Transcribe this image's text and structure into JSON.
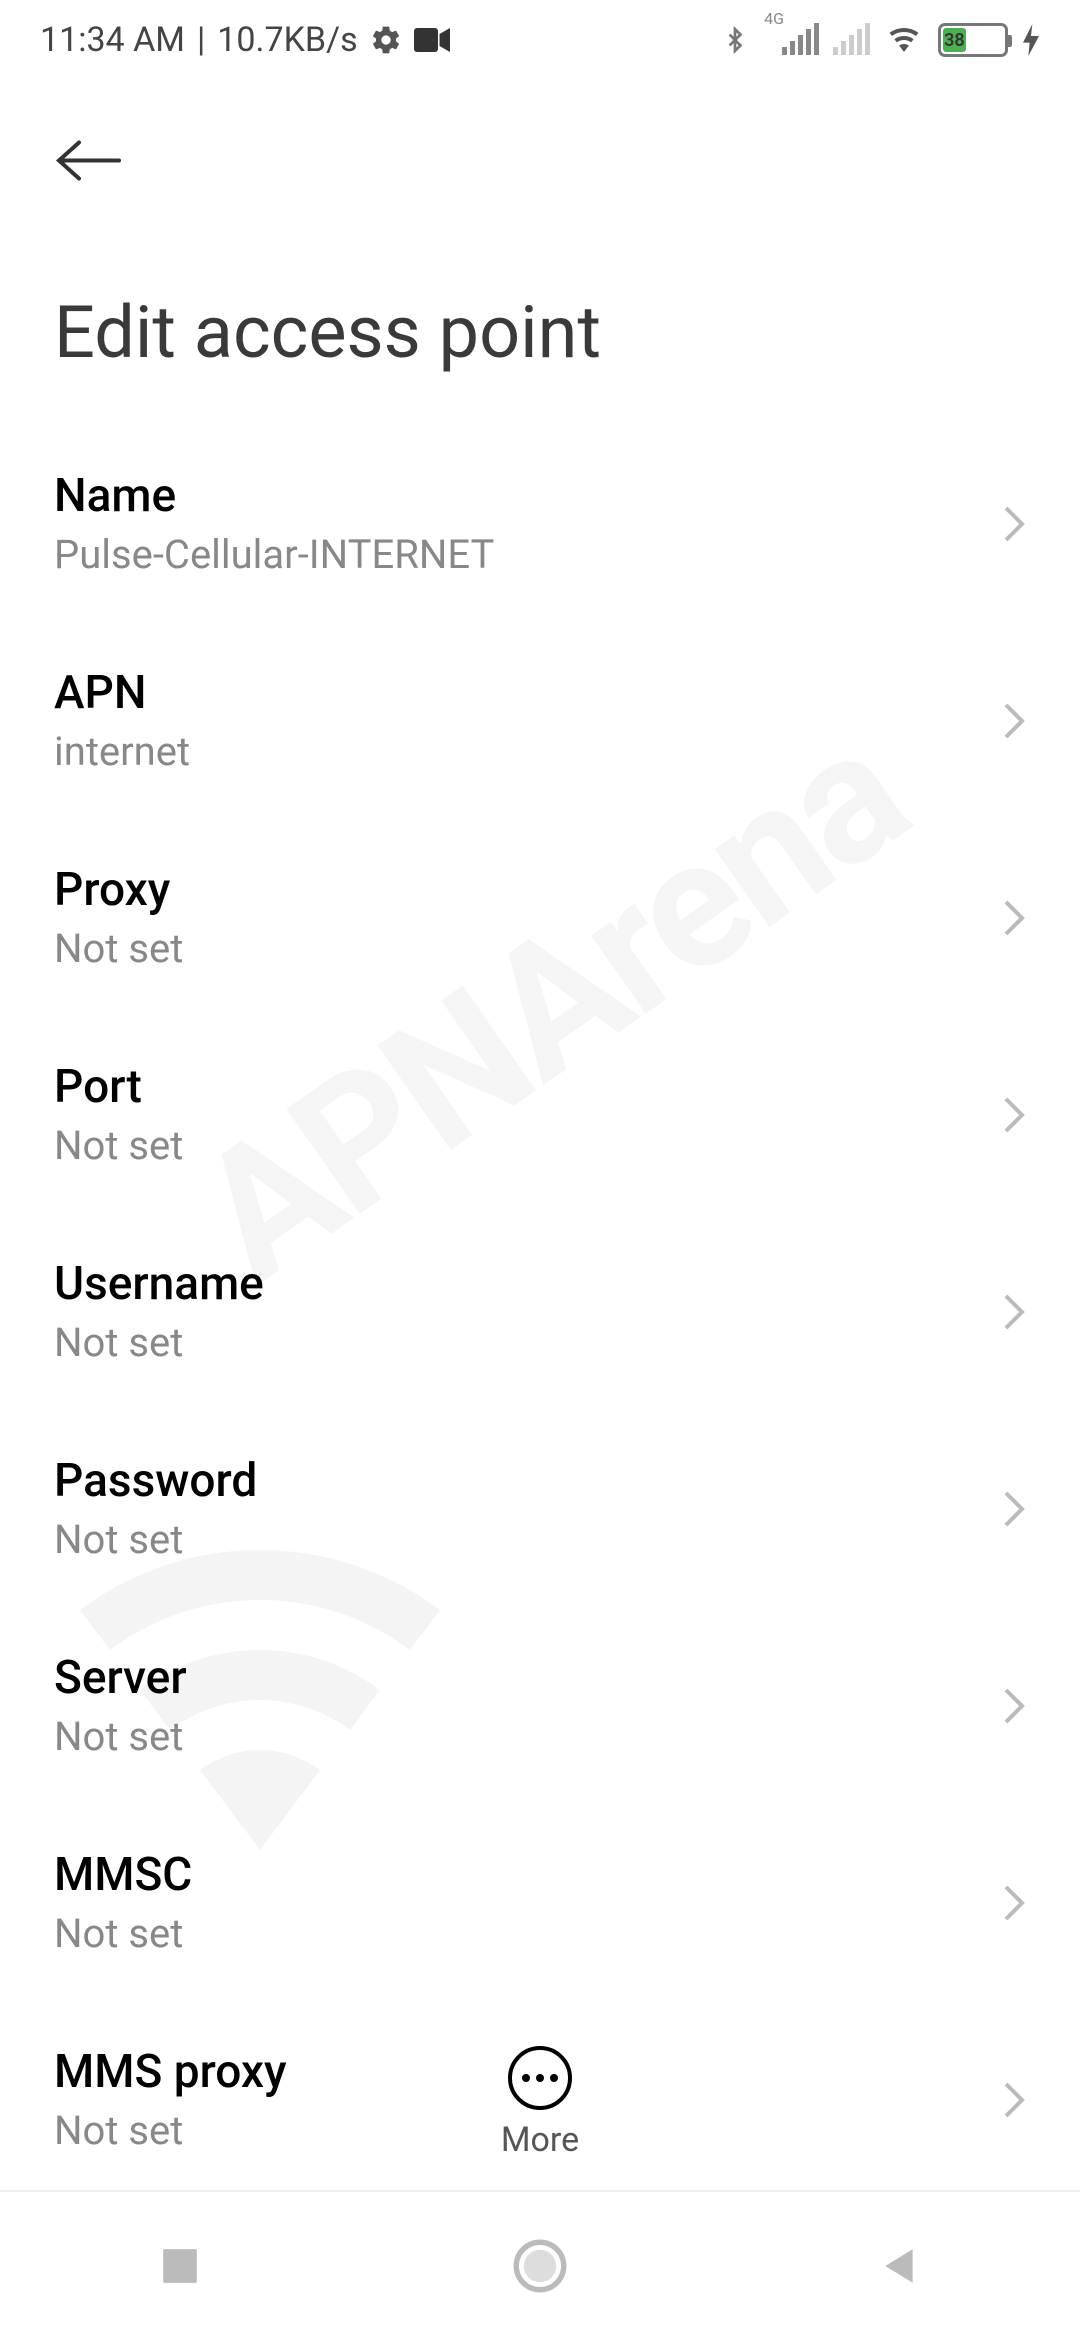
{
  "status_bar": {
    "time": "11:34 AM",
    "speed": "10.7KB/s",
    "network_badge": "4G",
    "battery_percent": "38"
  },
  "page_title": "Edit access point",
  "watermark_text": "APNArena",
  "settings": [
    {
      "label": "Name",
      "value": "Pulse-Cellular-INTERNET"
    },
    {
      "label": "APN",
      "value": "internet"
    },
    {
      "label": "Proxy",
      "value": "Not set"
    },
    {
      "label": "Port",
      "value": "Not set"
    },
    {
      "label": "Username",
      "value": "Not set"
    },
    {
      "label": "Password",
      "value": "Not set"
    },
    {
      "label": "Server",
      "value": "Not set"
    },
    {
      "label": "MMSC",
      "value": "Not set"
    },
    {
      "label": "MMS proxy",
      "value": "Not set"
    }
  ],
  "more_label": "More"
}
